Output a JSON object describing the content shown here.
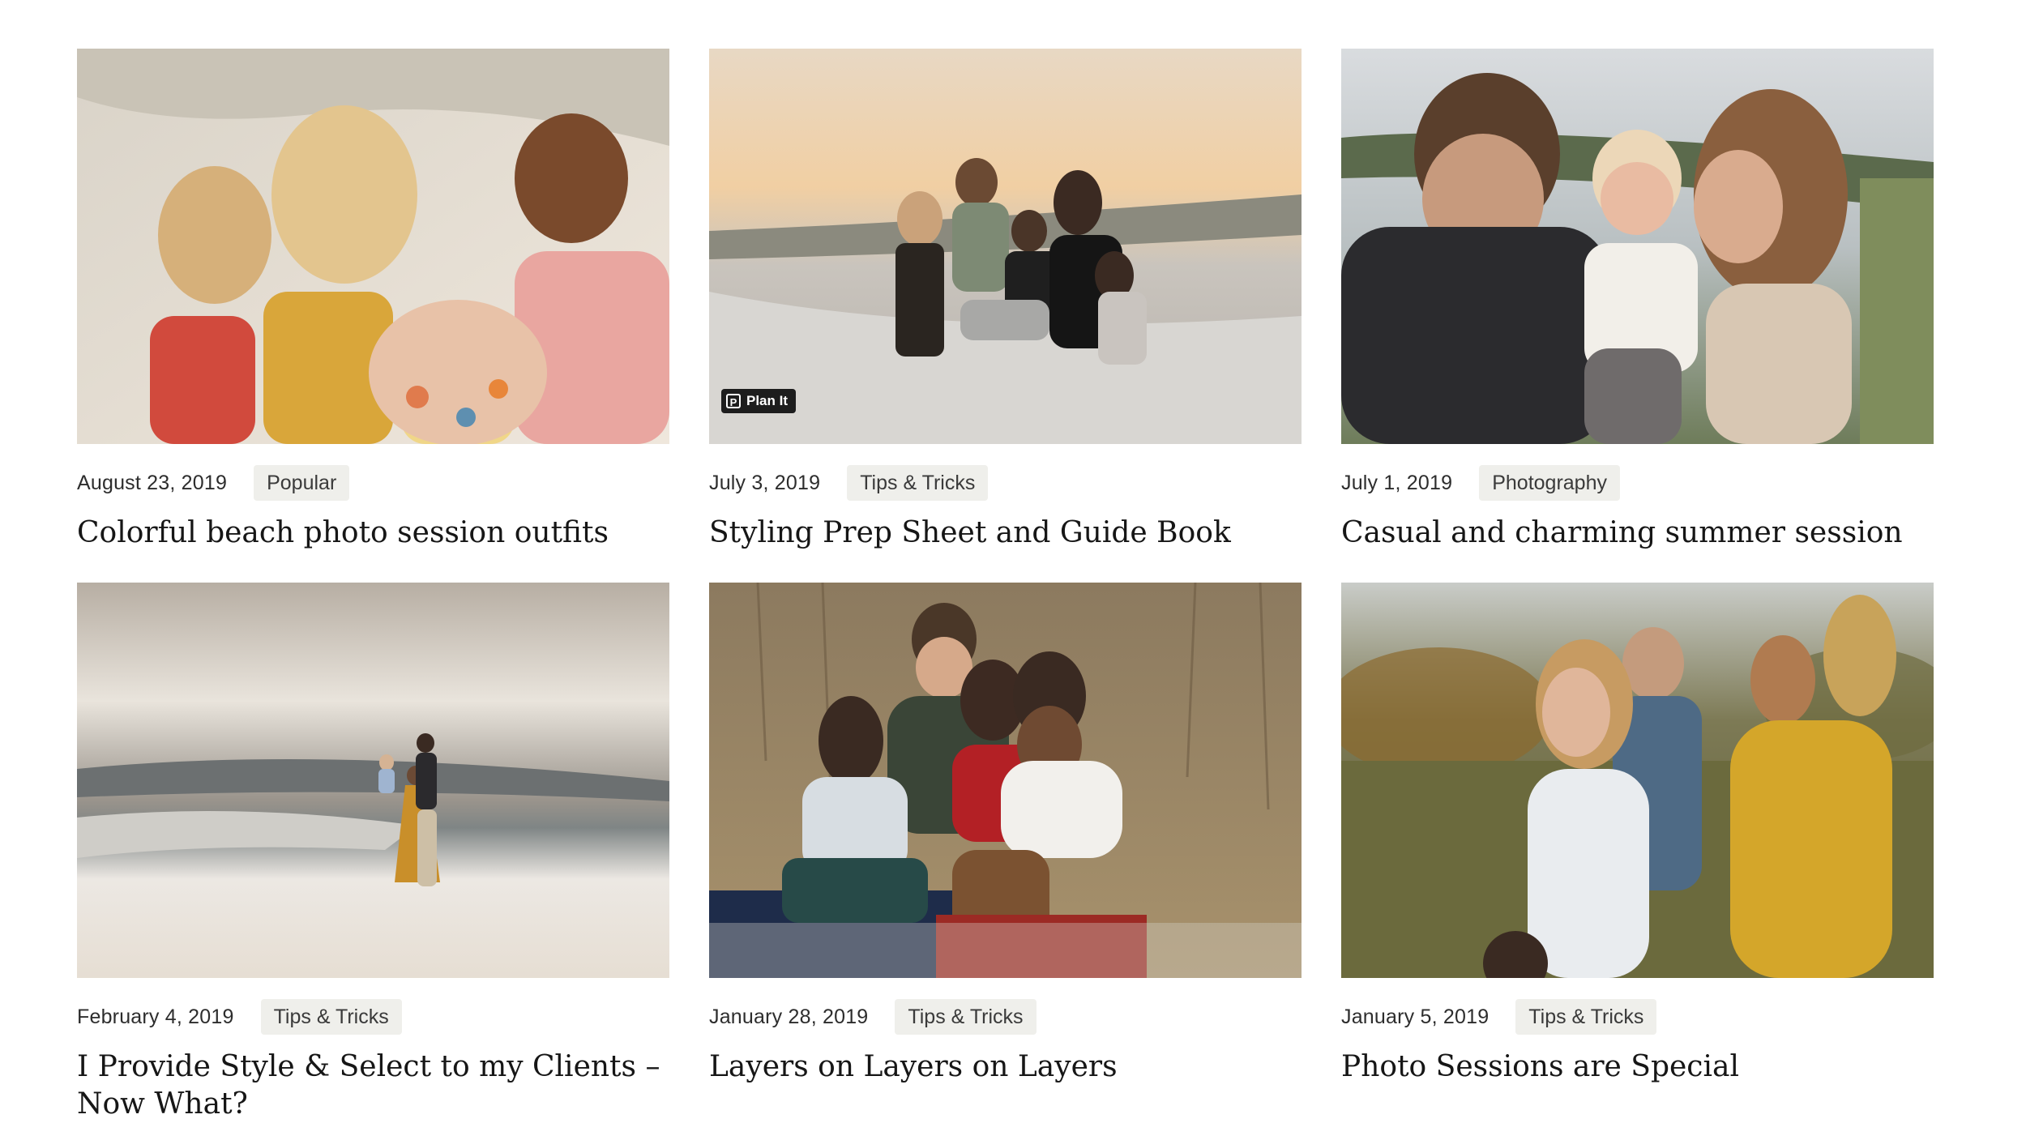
{
  "posts": [
    {
      "date": "August 23, 2019",
      "category": "Popular",
      "title": "Colorful beach photo session outfits"
    },
    {
      "date": "July 3, 2019",
      "category": "Tips & Tricks",
      "title": "Styling Prep Sheet and Guide Book",
      "badge": "Plan It",
      "badge_icon": "P"
    },
    {
      "date": "July 1, 2019",
      "category": "Photography",
      "title": "Casual and charming summer session"
    },
    {
      "date": "February 4, 2019",
      "category": "Tips & Tricks",
      "title": "I Provide Style & Select to my Clients – Now What?"
    },
    {
      "date": "January 28, 2019",
      "category": "Tips & Tricks",
      "title": "Layers on Layers on Layers"
    },
    {
      "date": "January 5, 2019",
      "category": "Tips & Tricks",
      "title": "Photo Sessions are Special"
    }
  ]
}
